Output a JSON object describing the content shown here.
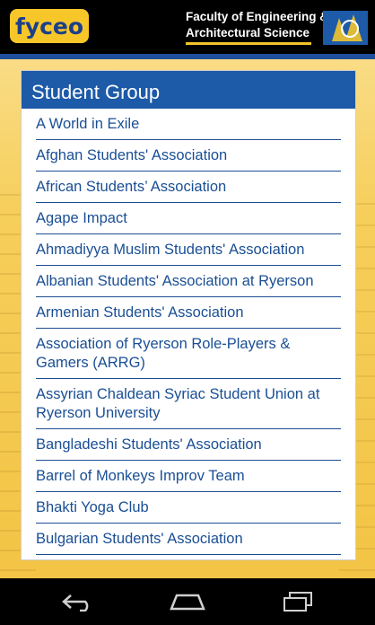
{
  "header": {
    "logo_text": "fyceo",
    "faculty_line1": "Faculty of Engineering &",
    "faculty_line2": "Architectural Science"
  },
  "card": {
    "title": "Student Group",
    "items": [
      "A World in Exile",
      "Afghan Students' Association",
      "African Students’ Association",
      "Agape Impact",
      "Ahmadiyya Muslim Students' Association",
      "Albanian Students' Association at Ryerson",
      "Armenian Students' Association",
      "Association of Ryerson Role-Players & Gamers (ARRG)",
      "Assyrian Chaldean Syriac Student Union at Ryerson University",
      "Bangladeshi Students' Association",
      "Barrel of Monkeys Improv Team",
      "Bhakti Yoga Club",
      "Bulgarian Students' Association"
    ]
  },
  "nav": {
    "back_icon": "back-icon",
    "home_icon": "home-icon",
    "recents_icon": "recents-icon"
  },
  "colors": {
    "accent_blue": "#1d5aa8",
    "logo_yellow": "#f7c72a",
    "link_blue": "#1a4f95"
  }
}
